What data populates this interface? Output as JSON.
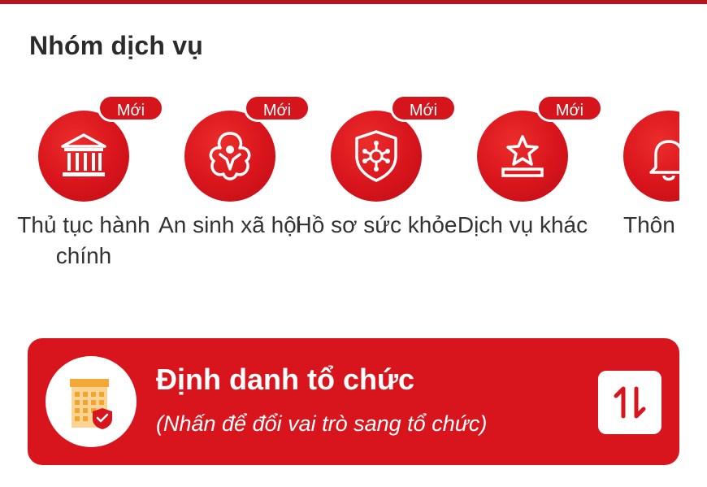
{
  "section": {
    "title": "Nhóm dịch vụ"
  },
  "services": [
    {
      "label": "Thủ tục hành chính",
      "badge": "Mới",
      "icon": "government-building-icon"
    },
    {
      "label": "An sinh xã hội",
      "badge": "Mới",
      "icon": "social-welfare-icon"
    },
    {
      "label": "Hồ sơ sức khỏe",
      "badge": "Mới",
      "icon": "health-shield-icon"
    },
    {
      "label": "Dịch vụ khác",
      "badge": "Mới",
      "icon": "star-podium-icon"
    },
    {
      "label": "Thôn từ cơ nhà",
      "icon": "bell-icon"
    }
  ],
  "org_banner": {
    "title": "Định danh tổ chức",
    "subtitle": "(Nhấn để đổi vai trò sang tổ chức)",
    "icon": "organization-building-icon",
    "switch_icon": "swap-arrows-icon"
  },
  "colors": {
    "primary": "#d8141c",
    "text": "#333333",
    "badge_border": "#ffffff"
  }
}
